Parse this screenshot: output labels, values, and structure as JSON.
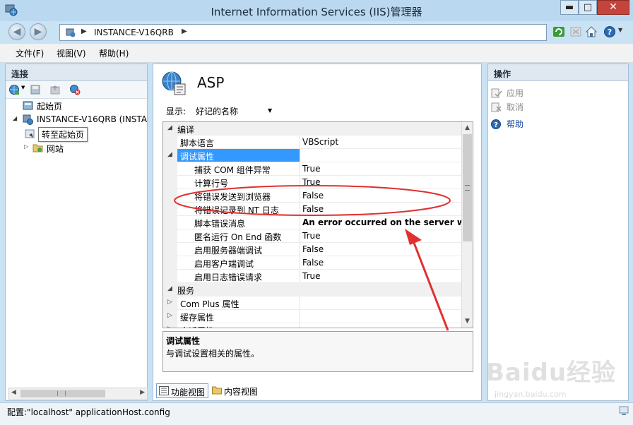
{
  "window": {
    "title": "Internet Information Services (IIS)管理器",
    "min_glyph": "▬",
    "max_glyph": "□",
    "close_glyph": "✕"
  },
  "address": {
    "path": [
      "INSTANCE-V16QRB"
    ],
    "sep": "▶"
  },
  "menu": {
    "file": "文件(F)",
    "view": "视图(V)",
    "help": "帮助(H)"
  },
  "connections": {
    "header": "连接",
    "tree": [
      {
        "label": "起始页",
        "icon": "start-page-icon"
      },
      {
        "label": "INSTANCE-V16QRB (INSTA",
        "icon": "server-icon",
        "expanded": true
      },
      {
        "label": "网站",
        "icon": "sites-folder-icon",
        "expanded": false
      }
    ],
    "tooltip": "转至起始页"
  },
  "feature": {
    "title": "ASP",
    "display_label": "显示:",
    "display_value": "好记的名称"
  },
  "grid": {
    "rows": [
      {
        "type": "category",
        "name": "编译",
        "expanded": true
      },
      {
        "type": "prop",
        "indent": 1,
        "name": "脚本语言",
        "value": "VBScript"
      },
      {
        "type": "category-sub",
        "name": "调试属性",
        "expanded": true,
        "selected": true,
        "value": ""
      },
      {
        "type": "prop",
        "indent": 2,
        "name": "捕获 COM 组件异常",
        "value": "True"
      },
      {
        "type": "prop",
        "indent": 2,
        "name": "计算行号",
        "value": "True"
      },
      {
        "type": "prop",
        "indent": 2,
        "name": "将错误发送到浏览器",
        "value": "False"
      },
      {
        "type": "prop",
        "indent": 2,
        "name": "将错误记录到 NT 日志",
        "value": "False"
      },
      {
        "type": "prop",
        "indent": 2,
        "name": "脚本错误消息",
        "value": "An error occurred on the server wher",
        "bold": true
      },
      {
        "type": "prop",
        "indent": 2,
        "name": "匿名运行 On End 函数",
        "value": "True"
      },
      {
        "type": "prop",
        "indent": 2,
        "name": "启用服务器端调试",
        "value": "False"
      },
      {
        "type": "prop",
        "indent": 2,
        "name": "启用客户端调试",
        "value": "False"
      },
      {
        "type": "prop",
        "indent": 2,
        "name": "启用日志错误请求",
        "value": "True"
      },
      {
        "type": "category",
        "name": "服务",
        "expanded": true
      },
      {
        "type": "category-sub",
        "name": "Com Plus 属性",
        "expanded": false,
        "value": ""
      },
      {
        "type": "category-sub",
        "name": "缓存属性",
        "expanded": false,
        "value": ""
      },
      {
        "type": "category-sub",
        "name": "会话属性",
        "expanded": false,
        "value": ""
      }
    ]
  },
  "description": {
    "title": "调试属性",
    "text": "与调试设置相关的属性。"
  },
  "view_tabs": {
    "features": "功能视图",
    "content": "内容视图"
  },
  "actions": {
    "header": "操作",
    "items": [
      {
        "label": "应用",
        "enabled": false,
        "icon": "apply-icon"
      },
      {
        "label": "取消",
        "enabled": false,
        "icon": "cancel-icon"
      },
      {
        "label": "帮助",
        "enabled": true,
        "icon": "help-icon"
      }
    ]
  },
  "status": {
    "text": "配置:\"localhost\" applicationHost.config"
  },
  "watermark": {
    "brand": "Baidu经验",
    "url": "jingyan.baidu.com"
  },
  "colors": {
    "selection": "#3399ff",
    "annotation": "#e03030"
  }
}
